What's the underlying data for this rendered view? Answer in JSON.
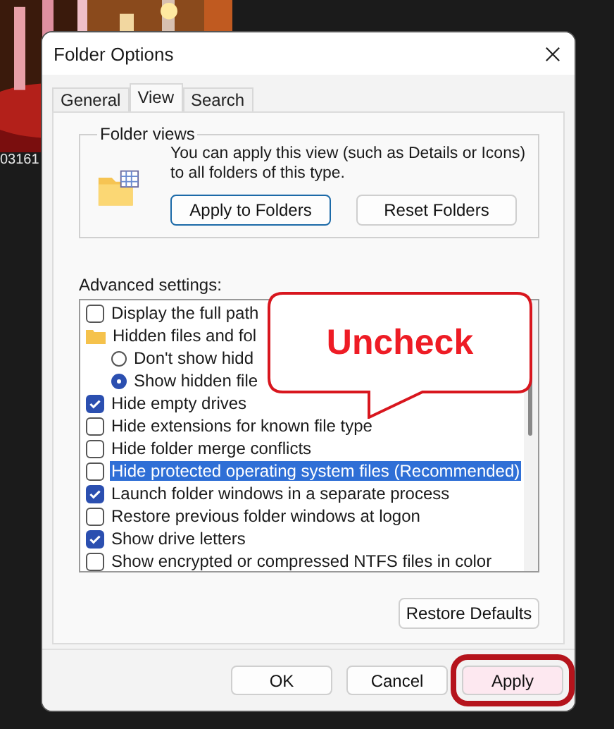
{
  "desktop": {
    "file_label": "03161"
  },
  "window": {
    "title": "Folder Options"
  },
  "tabs": [
    {
      "label": "General",
      "selected": false
    },
    {
      "label": "View",
      "selected": true
    },
    {
      "label": "Search",
      "selected": false
    }
  ],
  "folder_views": {
    "title": "Folder views",
    "text": "You can apply this view (such as Details or Icons) to all folders of this type.",
    "buttons": [
      "Apply to Folders",
      "Reset Folders"
    ]
  },
  "advanced_settings": {
    "label": "Advanced settings:",
    "items": [
      {
        "kind": "checkbox",
        "label": "Display the full path",
        "checked": false,
        "selected": false
      },
      {
        "kind": "folder",
        "label": "Hidden files and fol",
        "selected": false,
        "children": [
          {
            "kind": "radio",
            "label": "Don't show hidd",
            "checked": false,
            "selected": false
          },
          {
            "kind": "radio",
            "label": "Show hidden file",
            "checked": true,
            "selected": false
          }
        ]
      },
      {
        "kind": "checkbox",
        "label": "Hide empty drives",
        "checked": true,
        "selected": false
      },
      {
        "kind": "checkbox",
        "label": "Hide extensions for known file type",
        "checked": false,
        "selected": false
      },
      {
        "kind": "checkbox",
        "label": "Hide folder merge conflicts",
        "checked": false,
        "selected": false
      },
      {
        "kind": "checkbox",
        "label": "Hide protected operating system files (Recommended)",
        "checked": false,
        "selected": true
      },
      {
        "kind": "checkbox",
        "label": "Launch folder windows in a separate process",
        "checked": true,
        "selected": false
      },
      {
        "kind": "checkbox",
        "label": "Restore previous folder windows at logon",
        "checked": false,
        "selected": false
      },
      {
        "kind": "checkbox",
        "label": "Show drive letters",
        "checked": true,
        "selected": false
      },
      {
        "kind": "checkbox",
        "label": "Show encrypted or compressed NTFS files in color",
        "checked": false,
        "selected": false
      }
    ],
    "restore_button": "Restore Defaults"
  },
  "callout": {
    "text": "Uncheck"
  },
  "buttons": [
    {
      "label": "OK",
      "highlighted": false
    },
    {
      "label": "Cancel",
      "highlighted": false
    },
    {
      "label": "Apply",
      "highlighted": true
    }
  ]
}
